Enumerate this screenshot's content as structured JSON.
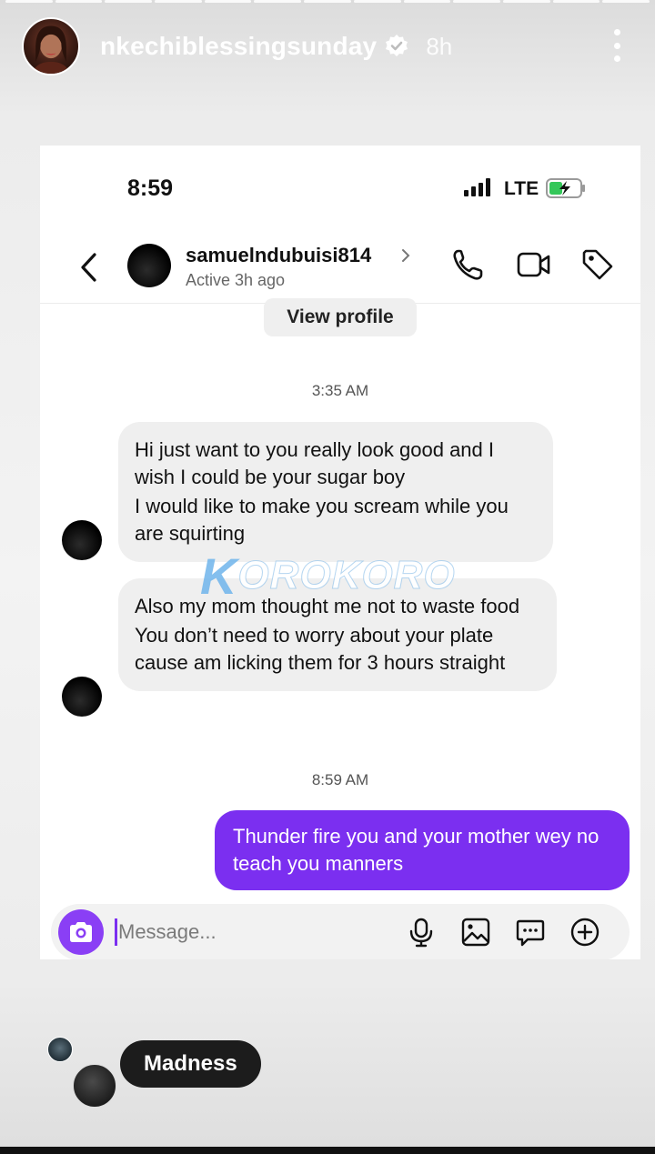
{
  "story": {
    "username": "nkechiblessingsunday",
    "time_ago": "8h",
    "progress_segments": 13
  },
  "status_bar": {
    "time": "8:59",
    "network": "LTE"
  },
  "dm": {
    "contact_name": "samuelndubuisi814",
    "active_status": "Active 3h ago",
    "view_profile_label": "View profile"
  },
  "thread": {
    "timestamp_1": "3:35 AM",
    "incoming_1": [
      "Hi just want to you really look good and I wish I could be your sugar boy",
      "I would like to make you scream while you are squirting"
    ],
    "incoming_2": [
      "Also my mom thought me not to waste food",
      "You don’t need to worry about your plate cause am licking them for 3 hours straight"
    ],
    "timestamp_2": "8:59 AM",
    "outgoing_1": "Thunder fire you and your mother wey no teach you manners"
  },
  "composer": {
    "placeholder": "Message..."
  },
  "watermark": {
    "text_k": "K",
    "text_rest": "OROKORO"
  },
  "reply": {
    "label": "Madness"
  },
  "colors": {
    "outgoing_bubble": "#7b2ff0",
    "camera_button": "#8a3ff5",
    "incoming_bubble": "#efefef"
  }
}
